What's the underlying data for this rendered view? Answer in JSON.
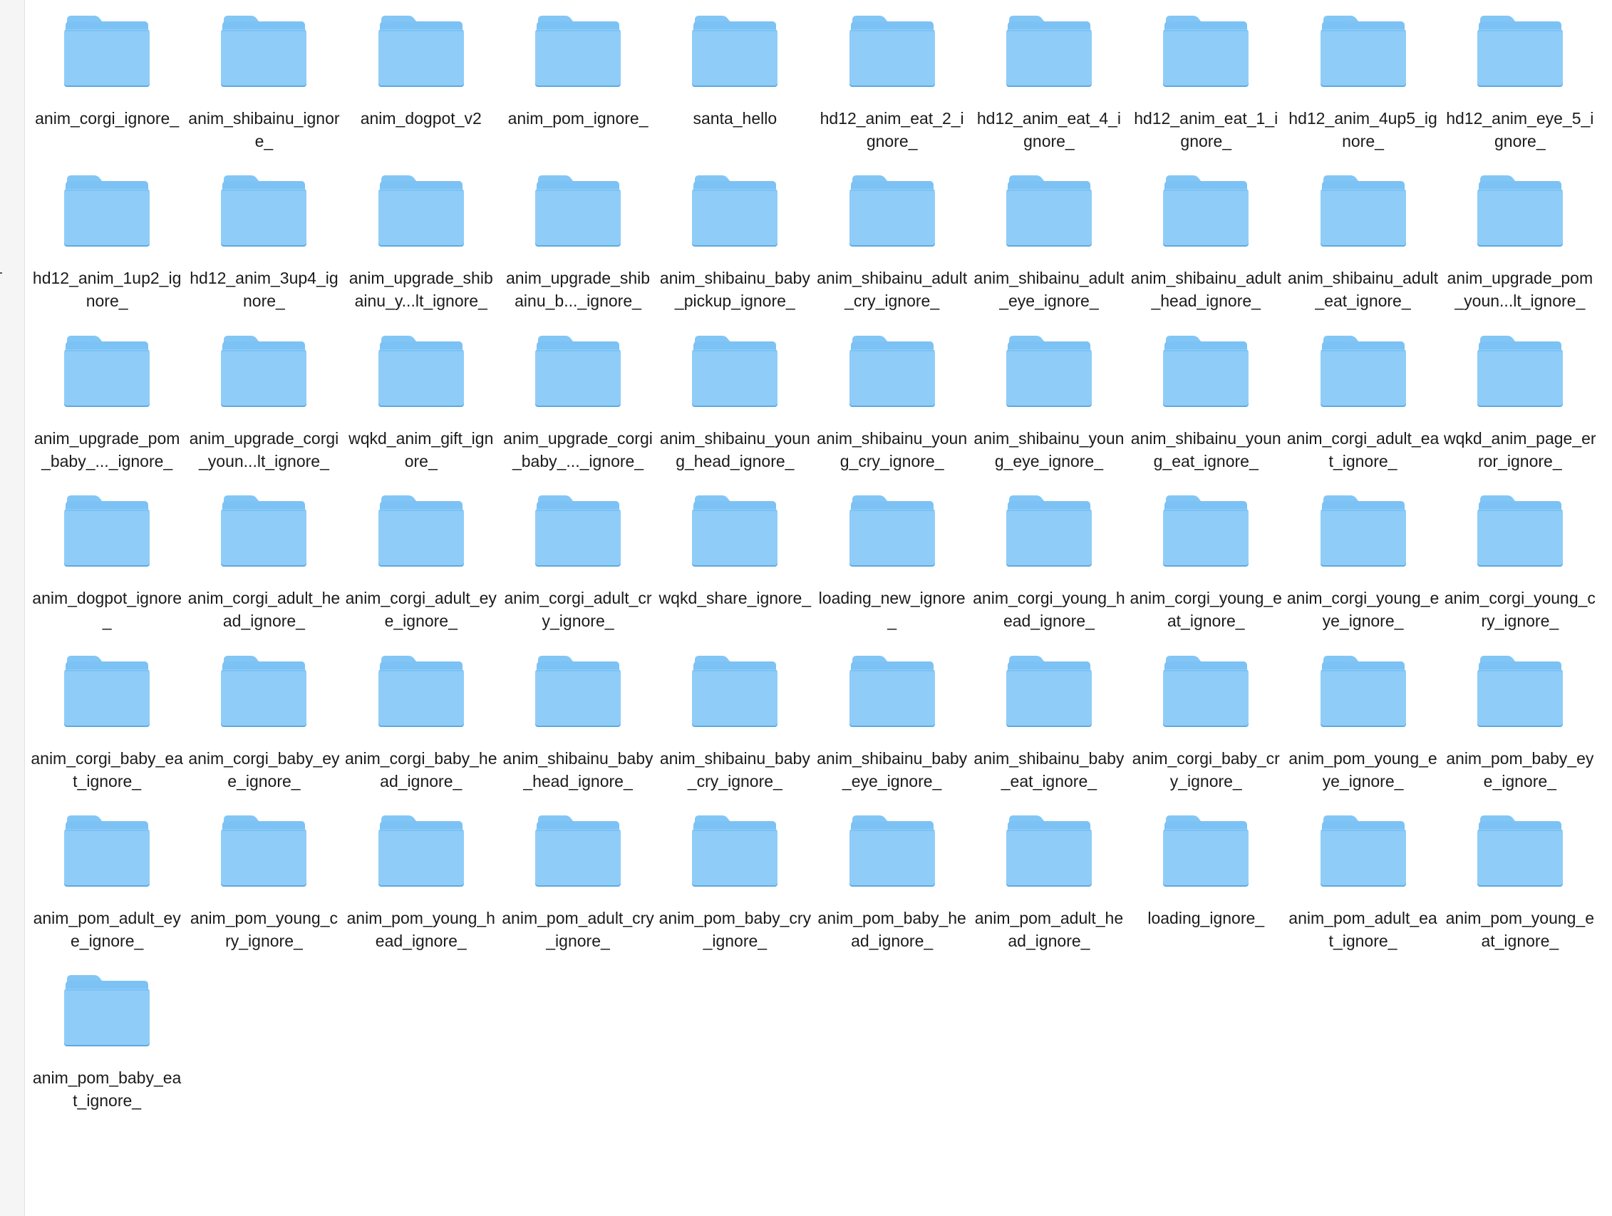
{
  "finder": {
    "items": [
      {
        "name": "anim_corgi_ignore_",
        "icon": "folder-icon"
      },
      {
        "name": "anim_shibainu_ignore_",
        "icon": "folder-icon"
      },
      {
        "name": "anim_dogpot_v2",
        "icon": "folder-icon"
      },
      {
        "name": "anim_pom_ignore_",
        "icon": "folder-icon"
      },
      {
        "name": "santa_hello",
        "icon": "folder-icon"
      },
      {
        "name": "hd12_anim_eat_2_ignore_",
        "icon": "folder-icon"
      },
      {
        "name": "hd12_anim_eat_4_ignore_",
        "icon": "folder-icon"
      },
      {
        "name": "hd12_anim_eat_1_ignore_",
        "icon": "folder-icon"
      },
      {
        "name": "hd12_anim_4up5_ignore_",
        "icon": "folder-icon"
      },
      {
        "name": "hd12_anim_eye_5_ignore_",
        "icon": "folder-icon"
      },
      {
        "name": "hd12_anim_1up2_ignore_",
        "icon": "folder-icon"
      },
      {
        "name": "hd12_anim_3up4_ignore_",
        "icon": "folder-icon"
      },
      {
        "name": "anim_upgrade_shibainu_y...lt_ignore_",
        "icon": "folder-icon"
      },
      {
        "name": "anim_upgrade_shibainu_b..._ignore_",
        "icon": "folder-icon"
      },
      {
        "name": "anim_shibainu_baby_pickup_ignore_",
        "icon": "folder-icon"
      },
      {
        "name": "anim_shibainu_adult_cry_ignore_",
        "icon": "folder-icon"
      },
      {
        "name": "anim_shibainu_adult_eye_ignore_",
        "icon": "folder-icon"
      },
      {
        "name": "anim_shibainu_adult_head_ignore_",
        "icon": "folder-icon"
      },
      {
        "name": "anim_shibainu_adult_eat_ignore_",
        "icon": "folder-icon"
      },
      {
        "name": "anim_upgrade_pom_youn...lt_ignore_",
        "icon": "folder-icon"
      },
      {
        "name": "anim_upgrade_pom_baby_..._ignore_",
        "icon": "folder-icon"
      },
      {
        "name": "anim_upgrade_corgi_youn...lt_ignore_",
        "icon": "folder-icon"
      },
      {
        "name": "wqkd_anim_gift_ignore_",
        "icon": "folder-icon"
      },
      {
        "name": "anim_upgrade_corgi_baby_..._ignore_",
        "icon": "folder-icon"
      },
      {
        "name": "anim_shibainu_young_head_ignore_",
        "icon": "folder-icon"
      },
      {
        "name": "anim_shibainu_young_cry_ignore_",
        "icon": "folder-icon"
      },
      {
        "name": "anim_shibainu_young_eye_ignore_",
        "icon": "folder-icon"
      },
      {
        "name": "anim_shibainu_young_eat_ignore_",
        "icon": "folder-icon"
      },
      {
        "name": "anim_corgi_adult_eat_ignore_",
        "icon": "folder-icon"
      },
      {
        "name": "wqkd_anim_page_error_ignore_",
        "icon": "folder-icon"
      },
      {
        "name": "anim_dogpot_ignore_",
        "icon": "folder-icon"
      },
      {
        "name": "anim_corgi_adult_head_ignore_",
        "icon": "folder-icon"
      },
      {
        "name": "anim_corgi_adult_eye_ignore_",
        "icon": "folder-icon"
      },
      {
        "name": "anim_corgi_adult_cry_ignore_",
        "icon": "folder-icon"
      },
      {
        "name": "wqkd_share_ignore_",
        "icon": "folder-icon"
      },
      {
        "name": "loading_new_ignore_",
        "icon": "folder-icon"
      },
      {
        "name": "anim_corgi_young_head_ignore_",
        "icon": "folder-icon"
      },
      {
        "name": "anim_corgi_young_eat_ignore_",
        "icon": "folder-icon"
      },
      {
        "name": "anim_corgi_young_eye_ignore_",
        "icon": "folder-icon"
      },
      {
        "name": "anim_corgi_young_cry_ignore_",
        "icon": "folder-icon"
      },
      {
        "name": "anim_corgi_baby_eat_ignore_",
        "icon": "folder-icon"
      },
      {
        "name": "anim_corgi_baby_eye_ignore_",
        "icon": "folder-icon"
      },
      {
        "name": "anim_corgi_baby_head_ignore_",
        "icon": "folder-icon"
      },
      {
        "name": "anim_shibainu_baby_head_ignore_",
        "icon": "folder-icon"
      },
      {
        "name": "anim_shibainu_baby_cry_ignore_",
        "icon": "folder-icon"
      },
      {
        "name": "anim_shibainu_baby_eye_ignore_",
        "icon": "folder-icon"
      },
      {
        "name": "anim_shibainu_baby_eat_ignore_",
        "icon": "folder-icon"
      },
      {
        "name": "anim_corgi_baby_cry_ignore_",
        "icon": "folder-icon"
      },
      {
        "name": "anim_pom_young_eye_ignore_",
        "icon": "folder-icon"
      },
      {
        "name": "anim_pom_baby_eye_ignore_",
        "icon": "folder-icon"
      },
      {
        "name": "anim_pom_adult_eye_ignore_",
        "icon": "folder-icon"
      },
      {
        "name": "anim_pom_young_cry_ignore_",
        "icon": "folder-icon"
      },
      {
        "name": "anim_pom_young_head_ignore_",
        "icon": "folder-icon"
      },
      {
        "name": "anim_pom_adult_cry_ignore_",
        "icon": "folder-icon"
      },
      {
        "name": "anim_pom_baby_cry_ignore_",
        "icon": "folder-icon"
      },
      {
        "name": "anim_pom_baby_head_ignore_",
        "icon": "folder-icon"
      },
      {
        "name": "anim_pom_adult_head_ignore_",
        "icon": "folder-icon"
      },
      {
        "name": "loading_ignore_",
        "icon": "folder-icon"
      },
      {
        "name": "anim_pom_adult_eat_ignore_",
        "icon": "folder-icon"
      },
      {
        "name": "anim_pom_young_eat_ignore_",
        "icon": "folder-icon"
      },
      {
        "name": "anim_pom_baby_eat_ignore_",
        "icon": "folder-icon"
      }
    ]
  },
  "colors": {
    "folder_back": "#7cc2f4",
    "folder_front": "#8fcdf8",
    "folder_tab": "#82c6f6",
    "folder_shadow": "#5fa9de"
  }
}
